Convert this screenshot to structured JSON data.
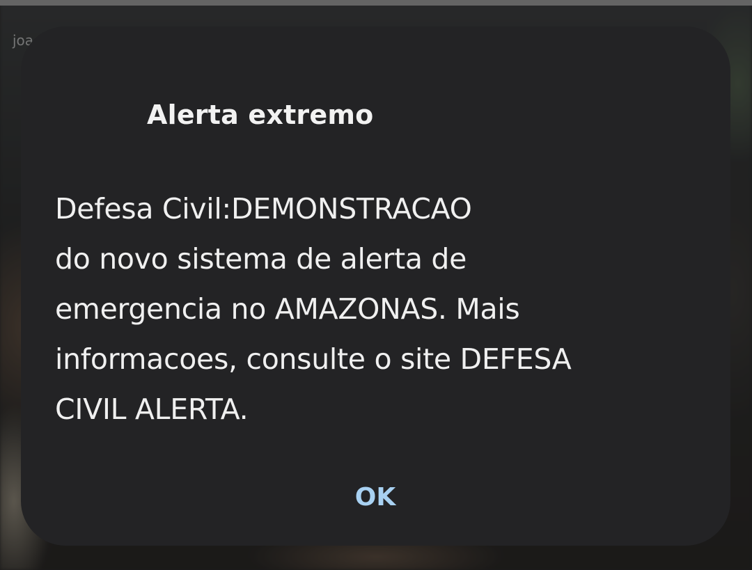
{
  "background": {
    "username_hint": "joa"
  },
  "alert": {
    "title": "Alerta extremo",
    "message": "Defesa Civil:DEMONSTRACAO\ndo novo sistema de alerta de\nemergencia no AMAZONAS. Mais\ninformacoes, consulte o site DEFESA\nCIVIL ALERTA.",
    "ok_label": "OK"
  },
  "colors": {
    "dialog_background": "#232325",
    "title_text": "#f2f2f2",
    "body_text": "#f0f0f0",
    "button_accent": "#a8d1f2"
  }
}
